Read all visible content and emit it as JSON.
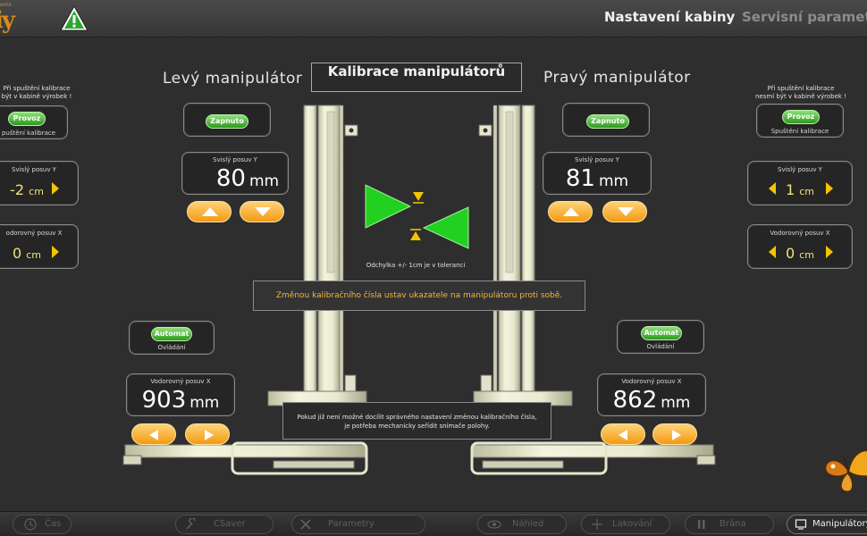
{
  "header": {
    "logo_small": "ems",
    "logo_big": "iy",
    "tabs": [
      "Nastavení kabiny",
      "Servisní parametry"
    ]
  },
  "title": "Kalibrace manipulátorů",
  "left_manipulator": {
    "title": "Levý manipulátor",
    "status_button": "Zapnuto",
    "vertical": {
      "label": "Svislý posuv Y",
      "value": "80",
      "unit": "mm"
    },
    "mode_button": "Automat",
    "mode_label": "Ovládání",
    "horizontal": {
      "label": "Vodorovný posuv X",
      "value": "903",
      "unit": "mm"
    }
  },
  "right_manipulator": {
    "title": "Pravý manipulátor",
    "status_button": "Zapnuto",
    "vertical": {
      "label": "Svislý posuv Y",
      "value": "81",
      "unit": "mm"
    },
    "mode_button": "Automat",
    "mode_label": "Ovládání",
    "horizontal": {
      "label": "Vodorovný posuv X",
      "value": "862",
      "unit": "mm"
    }
  },
  "left_side": {
    "warning": "Při spuštění kalibrace nesmí být v kabině výrobek !",
    "warning_visible": "Při spuštění kalibrace\nbýt v kabině výrobek !",
    "run_button": "Provoz",
    "run_label": "Spuštění kalibrace",
    "run_label_visible": "puštění kalibrace",
    "vertical": {
      "label": "Svislý posuv Y",
      "label_visible": "Svislý posuv Y",
      "value": "-2",
      "unit": "cm"
    },
    "horizontal": {
      "label": "Vodorovný posuv X",
      "label_visible": "odorovný posuv X",
      "value": "0",
      "unit": "cm"
    }
  },
  "right_side": {
    "warning_line1": "Při spuštění kalibrace",
    "warning_line2": "nesmí být v kabině výrobek !",
    "run_button": "Provoz",
    "run_label": "Spuštění kalibrace",
    "vertical": {
      "label": "Svislý posuv Y",
      "value": "1",
      "unit": "cm"
    },
    "horizontal": {
      "label": "Vodorovný posuv X",
      "value": "0",
      "unit": "cm"
    }
  },
  "messages": {
    "tolerance": "Odchylka +/- 1cm je v toleranci",
    "instruction": "Změnou kalibračního čísla ustav ukazatele na manipulátoru proti sobě.",
    "fallback_line1": "Pokud již není možné docílit správného nastavení změnou kalibračního čísla,",
    "fallback_line2": "je potřeba mechanicky seřídit snímače polohy."
  },
  "bottom_nav": [
    {
      "label": "Čas",
      "icon": "clock-icon"
    },
    {
      "label": "CSaver",
      "icon": "wrench-icon"
    },
    {
      "label": "Parametry",
      "icon": "tools-icon"
    },
    {
      "label": "Náhled",
      "icon": "eye-icon"
    },
    {
      "label": "Lakování",
      "icon": "spray-icon"
    },
    {
      "label": "Brána",
      "icon": "pause-icon"
    },
    {
      "label": "Manipulátory",
      "icon": "monitor-icon",
      "active": true
    }
  ],
  "colors": {
    "accent_orange": "#f39a10",
    "button_green": "#2e9a1d",
    "indicator_green": "#22d022",
    "marker_yellow": "#f5c400",
    "message_orange": "#f5b53a"
  }
}
